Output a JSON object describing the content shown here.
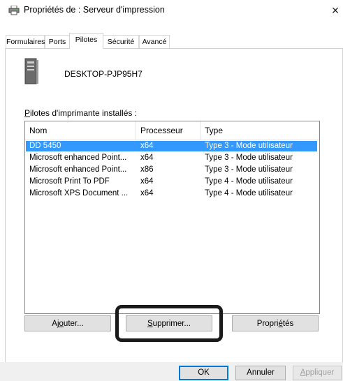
{
  "window": {
    "title": "Propriétés de : Serveur d'impression",
    "close_glyph": "×"
  },
  "tabs": [
    {
      "label": "Formulaires"
    },
    {
      "label": "Ports"
    },
    {
      "label": "Pilotes",
      "active": true
    },
    {
      "label": "Sécurité"
    },
    {
      "label": "Avancé"
    }
  ],
  "server": {
    "name": "DESKTOP-PJP95H7",
    "icon": "server-icon"
  },
  "drivers": {
    "label_accel": "P",
    "label_rest": "ilotes d'imprimante installés :",
    "columns": [
      "Nom",
      "Processeur",
      "Type"
    ],
    "rows": [
      {
        "name": "DD 5450",
        "processor": "x64",
        "type": "Type 3 - Mode utilisateur",
        "selected": true
      },
      {
        "name": "Microsoft enhanced Point...",
        "processor": "x64",
        "type": "Type 3 - Mode utilisateur"
      },
      {
        "name": "Microsoft enhanced Point...",
        "processor": "x86",
        "type": "Type 3 - Mode utilisateur"
      },
      {
        "name": "Microsoft Print To PDF",
        "processor": "x64",
        "type": "Type 4 - Mode utilisateur"
      },
      {
        "name": "Microsoft XPS Document ...",
        "processor": "x64",
        "type": "Type 4 - Mode utilisateur"
      }
    ]
  },
  "buttons": {
    "add": {
      "pre": "Aj",
      "accel": "o",
      "post": "uter..."
    },
    "remove": {
      "pre": "",
      "accel": "S",
      "post": "upprimer..."
    },
    "properties": {
      "pre": "Propri",
      "accel": "é",
      "post": "tés"
    }
  },
  "footer": {
    "ok": "OK",
    "cancel": "Annuler",
    "apply_accel": "A",
    "apply_rest": "ppliquer"
  },
  "colors": {
    "selection": "#3399ff",
    "highlight_frame": "#1a1a1a"
  }
}
